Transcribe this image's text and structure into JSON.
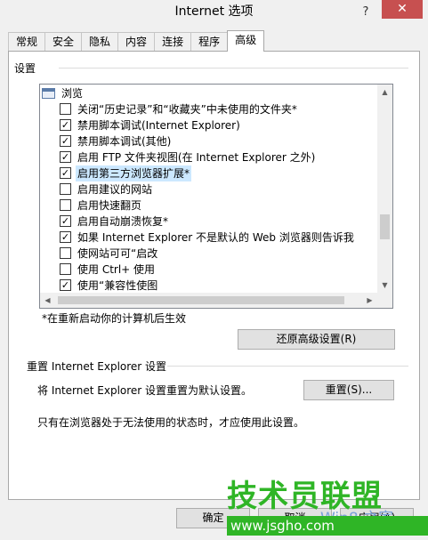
{
  "window": {
    "title": "Internet 选项",
    "help_label": "?",
    "close_label": "✕"
  },
  "tabs": [
    {
      "label": "常规"
    },
    {
      "label": "安全"
    },
    {
      "label": "隐私"
    },
    {
      "label": "内容"
    },
    {
      "label": "连接"
    },
    {
      "label": "程序"
    },
    {
      "label": "高级"
    }
  ],
  "active_tab": "高级",
  "settings": {
    "group_label": "设置",
    "category": "浏览",
    "items": [
      {
        "label": "关闭“历史记录”和“收藏夹”中未使用的文件夹*",
        "checked": false,
        "selected": false
      },
      {
        "label": "禁用脚本调试(Internet Explorer)",
        "checked": true,
        "selected": false
      },
      {
        "label": "禁用脚本调试(其他)",
        "checked": true,
        "selected": false
      },
      {
        "label": "启用 FTP 文件夹视图(在 Internet Explorer 之外)",
        "checked": true,
        "selected": false
      },
      {
        "label": "启用第三方浏览器扩展*",
        "checked": true,
        "selected": true
      },
      {
        "label": "启用建议的网站",
        "checked": false,
        "selected": false
      },
      {
        "label": "启用快速翻页",
        "checked": false,
        "selected": false
      },
      {
        "label": "启用自动崩溃恢复*",
        "checked": true,
        "selected": false
      },
      {
        "label": "如果 Internet Explorer 不是默认的 Web 浏览器则告诉我",
        "checked": true,
        "selected": false
      },
      {
        "label": "使网站可可“启改",
        "checked": false,
        "selected": false
      },
      {
        "label": "使用 Ctrl+  使用",
        "checked": false,
        "selected": false
      },
      {
        "label": "使用“兼容性使图",
        "checked": true,
        "selected": false
      }
    ],
    "restart_note": "*在重新启动你的计算机后生效",
    "restore_button": "还原高级设置(R)"
  },
  "reset": {
    "title": "重置 Internet Explorer 设置",
    "description": "将 Internet Explorer 设置重置为默认设置。",
    "button": "重置(S)...",
    "note": "只有在浏览器处于无法使用的状态时，才应使用此设置。"
  },
  "footer": {
    "ok_button": "确定",
    "cancel_button": "取消",
    "apply_button": "应用(A)"
  },
  "watermark": {
    "brand": "技术员联盟",
    "url": "www.jsgho.com",
    "secondary": "Win8 之家"
  },
  "colors": {
    "selection": "#cce8ff",
    "close_button": "#c75050",
    "watermark_green": "#2fb526"
  }
}
